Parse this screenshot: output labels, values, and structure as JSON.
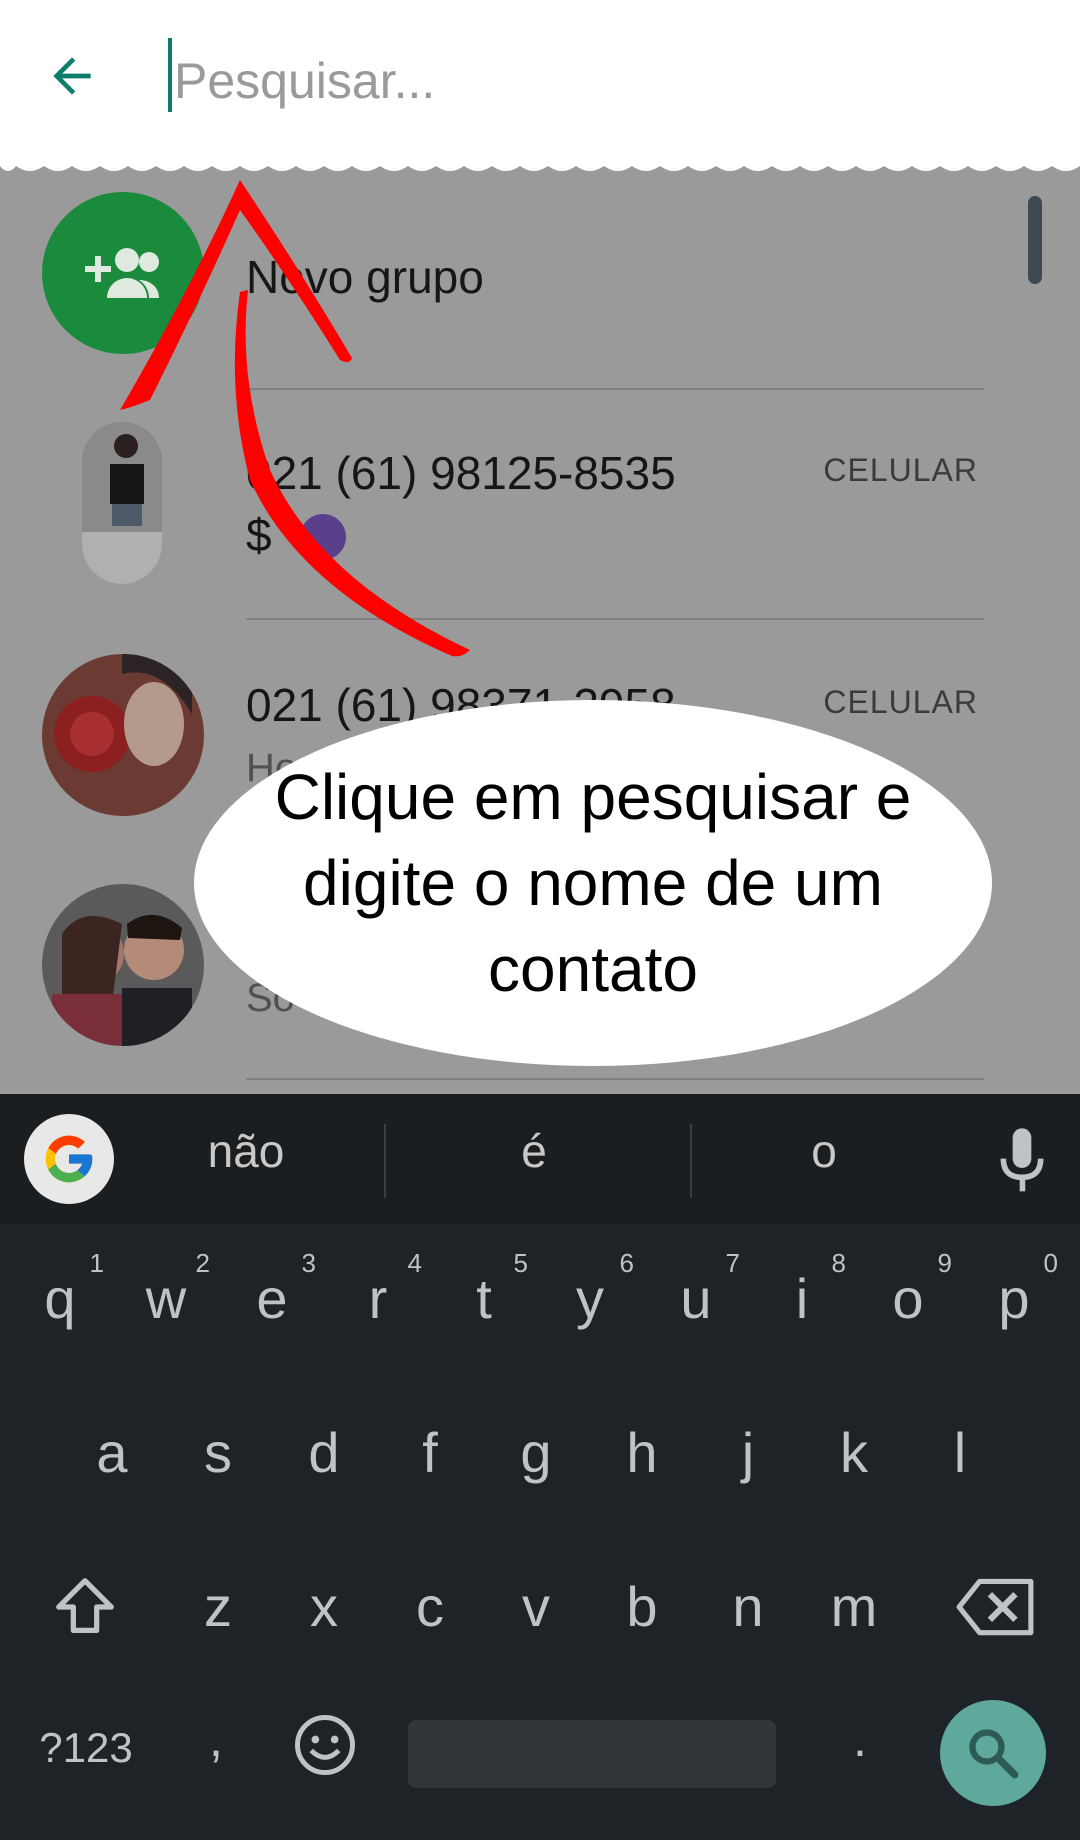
{
  "search": {
    "placeholder": "Pesquisar..."
  },
  "list": {
    "new_group": {
      "label": "Novo grupo"
    },
    "contacts": [
      {
        "name": "021 (61) 98125-8535",
        "status": "$",
        "type": "CELULAR"
      },
      {
        "name": "021 (61) 98371-2958",
        "status": "Ho",
        "type": "CELULAR"
      },
      {
        "name": "",
        "status": "So",
        "type": ""
      }
    ]
  },
  "annotation": {
    "text": "Clique em pesquisar e digite o nome de um contato",
    "arrow_color": "#ff0000"
  },
  "keyboard": {
    "suggestions": [
      "não",
      "é",
      "o"
    ],
    "row1": [
      {
        "k": "q",
        "h": "1"
      },
      {
        "k": "w",
        "h": "2"
      },
      {
        "k": "e",
        "h": "3"
      },
      {
        "k": "r",
        "h": "4"
      },
      {
        "k": "t",
        "h": "5"
      },
      {
        "k": "y",
        "h": "6"
      },
      {
        "k": "u",
        "h": "7"
      },
      {
        "k": "i",
        "h": "8"
      },
      {
        "k": "o",
        "h": "9"
      },
      {
        "k": "p",
        "h": "0"
      }
    ],
    "row2": [
      "a",
      "s",
      "d",
      "f",
      "g",
      "h",
      "j",
      "k",
      "l"
    ],
    "row3": [
      "z",
      "x",
      "c",
      "v",
      "b",
      "n",
      "m"
    ],
    "symbols_label": "?123",
    "comma": ",",
    "period": "."
  },
  "colors": {
    "accent": "#0e7c6c",
    "group_avatar": "#1a8a3c",
    "keyboard_bg": "#1e2327",
    "search_key": "#5fa89c"
  }
}
